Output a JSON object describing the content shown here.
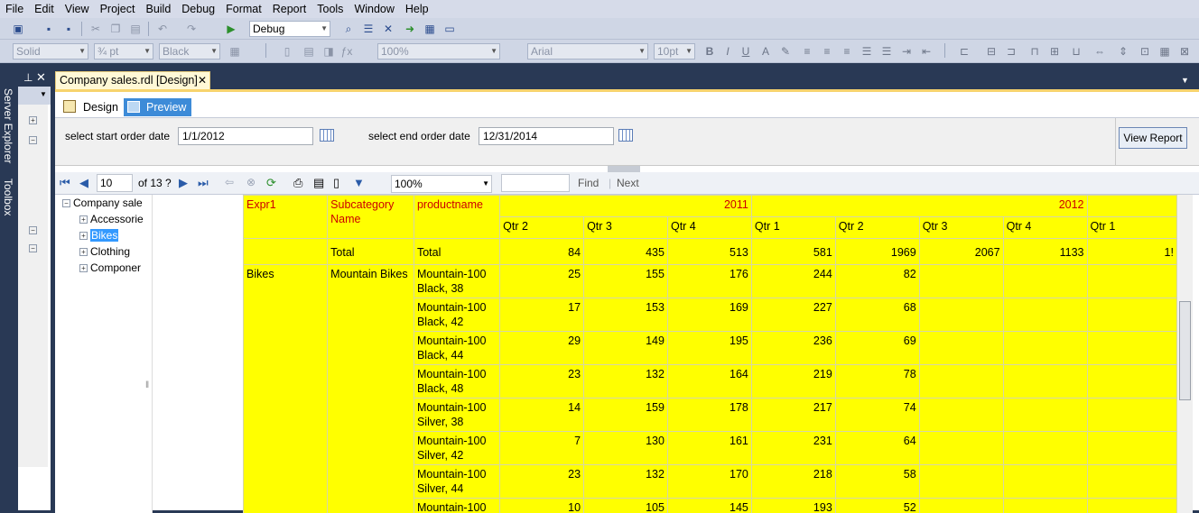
{
  "menu": [
    "File",
    "Edit",
    "View",
    "Project",
    "Build",
    "Debug",
    "Format",
    "Report",
    "Tools",
    "Window",
    "Help"
  ],
  "toolbar1": {
    "config": "Debug"
  },
  "toolbar2": {
    "line_style": "Solid",
    "line_width": "¾ pt",
    "color": "Black",
    "zoom": "100%",
    "font": "Arial",
    "font_size": "10pt"
  },
  "side_tabs": [
    "Server Explorer",
    "Toolbox"
  ],
  "doc_tab": {
    "title": "Company sales.rdl [Design]",
    "close": "✕"
  },
  "view_tabs": {
    "design": "Design",
    "preview": "Preview"
  },
  "params": {
    "start_label": "select start order date",
    "start_value": "1/1/2012",
    "end_label": "select end order date",
    "end_value": "12/31/2014",
    "view_report": "View Report"
  },
  "report_toolbar": {
    "page": "10",
    "of": "of 13 ?",
    "zoom": "100%",
    "find": "Find",
    "next": "Next"
  },
  "doc_map": {
    "root": "Company sale",
    "items": [
      "Accessorie",
      "Bikes",
      "Clothing",
      "Componer"
    ],
    "selected": "Bikes"
  },
  "table": {
    "header": {
      "expr": "Expr1",
      "subcat": "Subcategory Name",
      "product": "productname",
      "year1": "2011",
      "year2": "2012"
    },
    "quarters": [
      "Qtr 2",
      "Qtr 3",
      "Qtr 4",
      "Qtr 1",
      "Qtr 2",
      "Qtr 3",
      "Qtr 4",
      "Qtr 1"
    ],
    "total_row": {
      "subcat": "Total",
      "product": "Total",
      "values": [
        "84",
        "435",
        "513",
        "581",
        "1969",
        "2067",
        "1133",
        "1!"
      ]
    },
    "group": {
      "category": "Bikes",
      "subcategory": "Mountain Bikes"
    },
    "rows": [
      {
        "product": "Mountain-100 Black, 38",
        "values": [
          "25",
          "155",
          "176",
          "244",
          "82"
        ]
      },
      {
        "product": "Mountain-100 Black, 42",
        "values": [
          "17",
          "153",
          "169",
          "227",
          "68"
        ]
      },
      {
        "product": "Mountain-100 Black, 44",
        "values": [
          "29",
          "149",
          "195",
          "236",
          "69"
        ]
      },
      {
        "product": "Mountain-100 Black, 48",
        "values": [
          "23",
          "132",
          "164",
          "219",
          "78"
        ]
      },
      {
        "product": "Mountain-100 Silver, 38",
        "values": [
          "14",
          "159",
          "178",
          "217",
          "74"
        ]
      },
      {
        "product": "Mountain-100 Silver, 42",
        "values": [
          "7",
          "130",
          "161",
          "231",
          "64"
        ]
      },
      {
        "product": "Mountain-100 Silver, 44",
        "values": [
          "23",
          "132",
          "170",
          "218",
          "58"
        ]
      },
      {
        "product": "Mountain-100",
        "values": [
          "10",
          "105",
          "145",
          "193",
          "52"
        ]
      }
    ]
  }
}
